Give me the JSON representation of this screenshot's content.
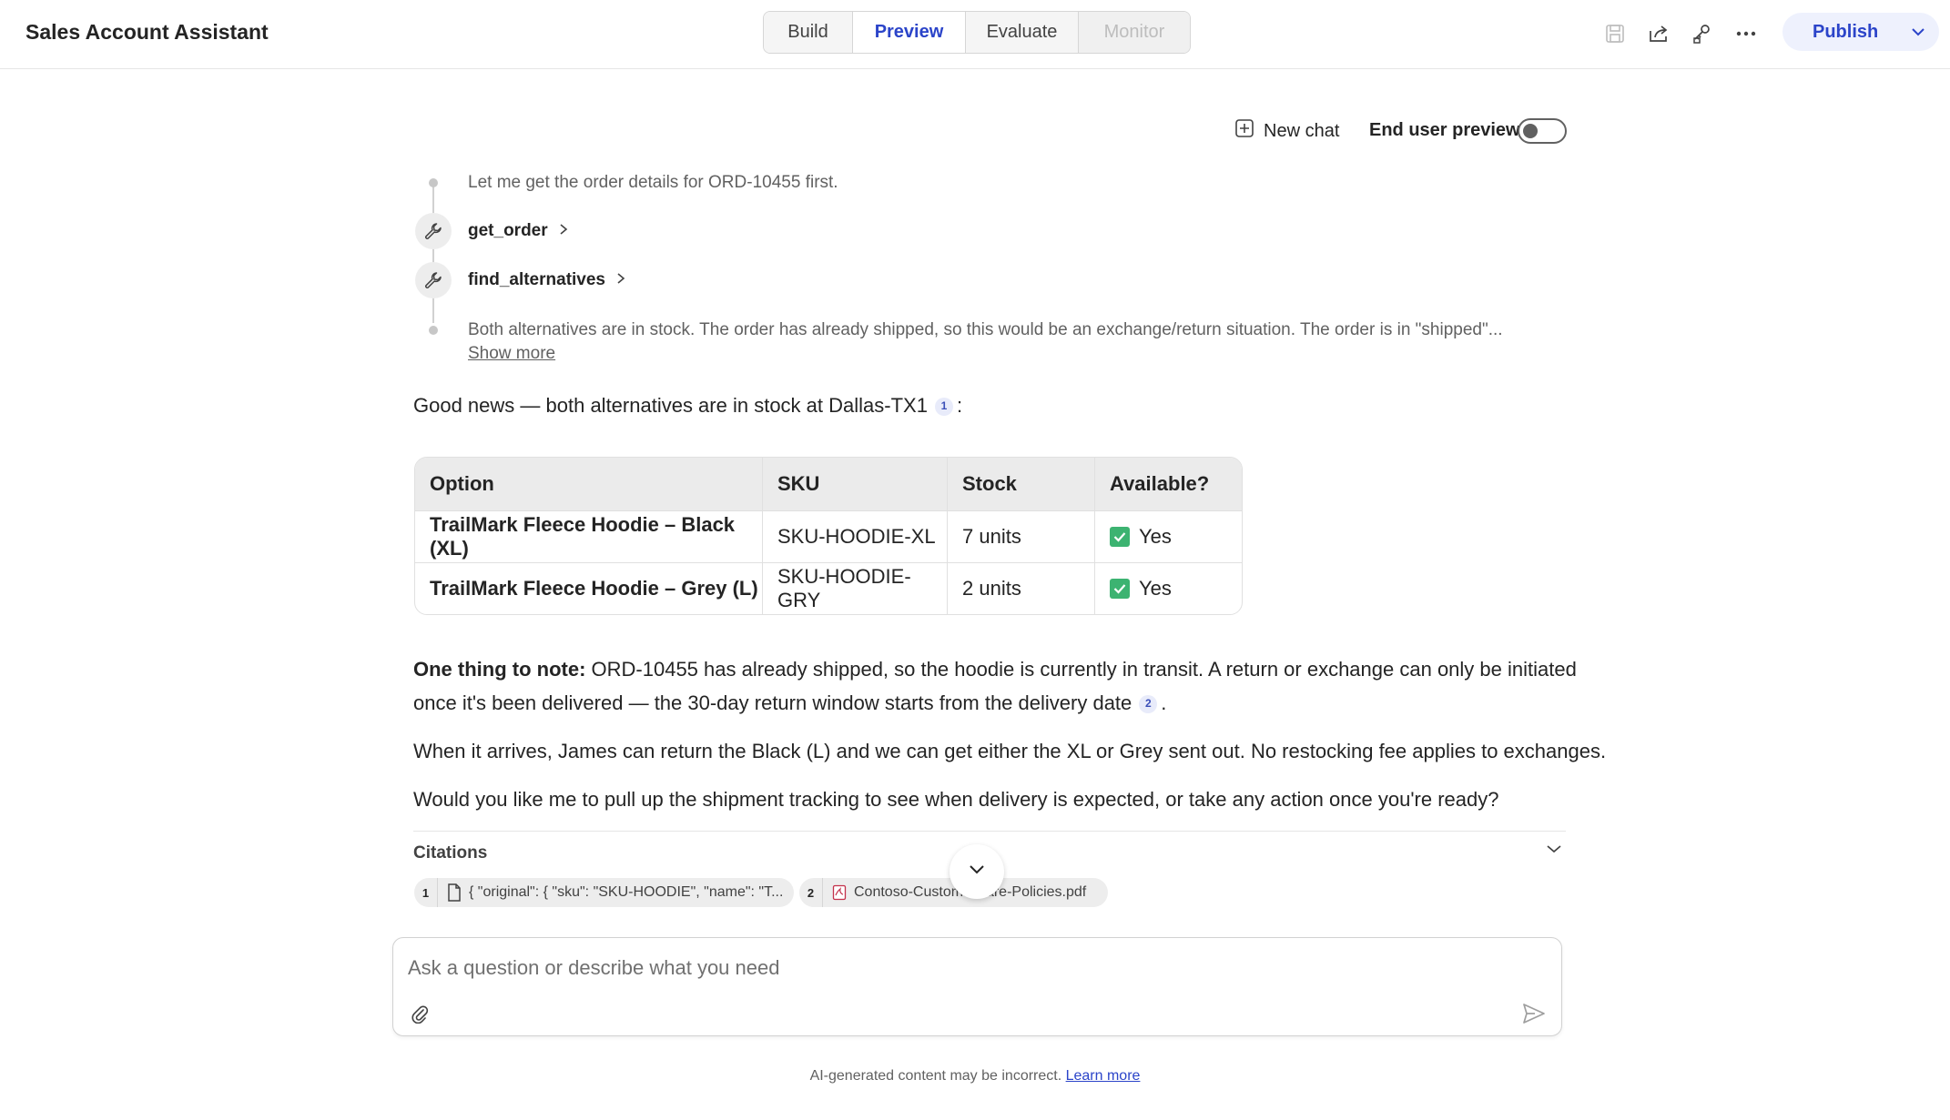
{
  "app": {
    "title": "Sales Account Assistant"
  },
  "tabs": [
    {
      "label": "Build"
    },
    {
      "label": "Preview"
    },
    {
      "label": "Evaluate"
    },
    {
      "label": "Monitor"
    }
  ],
  "toolbar": {
    "icons": [
      "save-icon",
      "share-icon",
      "connect-icon",
      "more-icon"
    ],
    "publish_label": "Publish"
  },
  "chat_header": {
    "new_chat_label": "New chat",
    "end_user_preview_label": "End user preview",
    "end_user_preview_on": false
  },
  "reasoning": {
    "step1_text": "Let me get the order details for ORD-10455 first.",
    "tool1_name": "get_order",
    "tool2_name": "find_alternatives",
    "step2_text": "Both alternatives are in stock. The order has already shipped, so this would be an exchange/return situation. The order is in \"shipped\"...",
    "show_more_label": "Show more"
  },
  "message": {
    "intro": "Good news — both alternatives are in stock at Dallas-TX1",
    "intro_cite": "1",
    "intro_end": ":",
    "table": {
      "headers": [
        "Option",
        "SKU",
        "Stock",
        "Available?"
      ],
      "rows": [
        {
          "option": "TrailMark Fleece Hoodie – Black (XL)",
          "sku": "SKU-HOODIE-XL",
          "stock": "7 units",
          "available": "Yes"
        },
        {
          "option": "TrailMark Fleece Hoodie – Grey (L)",
          "sku": "SKU-HOODIE-GRY",
          "stock": "2 units",
          "available": "Yes"
        }
      ]
    },
    "note_bold": "One thing to note:",
    "note_line1": " ORD-10455 has already shipped, so the hoodie is currently in transit. A return or exchange can only be initiated",
    "note_line2": "once it's been delivered — the 30-day return window starts from the delivery date",
    "note_cite": "2",
    "note_end": ".",
    "para2": "When it arrives, James can return the Black (L) and we can get either the XL or Grey sent out. No restocking fee applies to exchanges.",
    "para3": "Would you like me to pull up the shipment tracking to see when delivery is expected, or take any action once you're ready?"
  },
  "citations": {
    "label": "Citations",
    "items": [
      {
        "num": "1",
        "text": "{ \"original\": { \"sku\": \"SKU-HOODIE\", \"name\": \"T...",
        "icon": "document-icon"
      },
      {
        "num": "2",
        "text": "Contoso-Custom...Care-Policies.pdf",
        "icon": "pdf-icon"
      }
    ]
  },
  "composer": {
    "placeholder": "Ask a question or describe what you need"
  },
  "footer": {
    "disclaimer": "AI-generated content may be incorrect.",
    "learn_more": "Learn more"
  }
}
